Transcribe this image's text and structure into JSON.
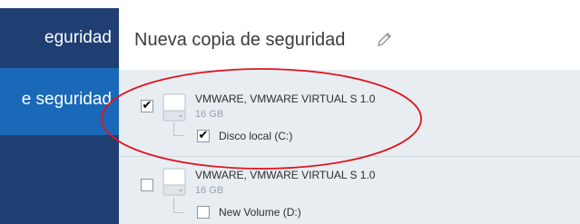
{
  "sidebar": {
    "items": [
      {
        "label": "eguridad"
      },
      {
        "label": "e seguridad"
      }
    ]
  },
  "header": {
    "title": "Nueva copia de seguridad",
    "edit_icon": "pencil-icon"
  },
  "disks": [
    {
      "name": "VMWARE, VMWARE VIRTUAL S 1.0",
      "size": "16 GB",
      "checked": true,
      "volume": {
        "name": "Disco local (C:)",
        "checked": true
      }
    },
    {
      "name": "VMWARE, VMWARE VIRTUAL S 1.0",
      "size": "16 GB",
      "checked": false,
      "volume": {
        "name": "New Volume (D:)",
        "checked": false
      }
    }
  ],
  "marks": {
    "checked": "✔",
    "unchecked": ""
  },
  "colors": {
    "sidebar_bg": "#1f3f73",
    "sidebar_active": "#1a68b8",
    "list_bg": "#e8edf2",
    "annotation_red": "#e0141e"
  }
}
